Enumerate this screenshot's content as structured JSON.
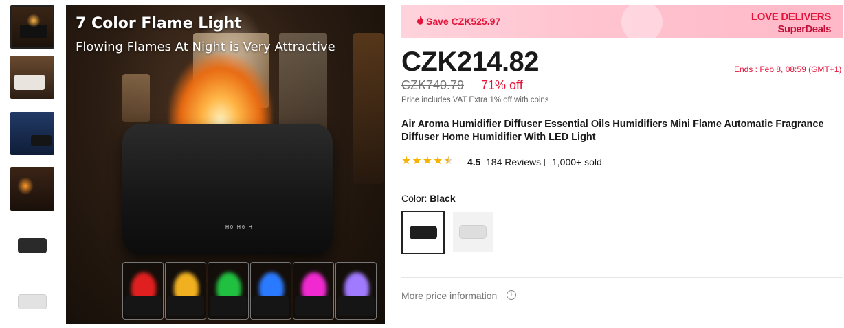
{
  "gallery": {
    "thumbnails": [
      {
        "name": "thumb-1",
        "active": true
      },
      {
        "name": "thumb-2",
        "active": false
      },
      {
        "name": "thumb-3",
        "active": false
      },
      {
        "name": "thumb-4",
        "active": false
      },
      {
        "name": "thumb-5",
        "active": false
      },
      {
        "name": "thumb-6",
        "active": false
      }
    ],
    "main_image": {
      "headline": "7 Color Flame Light",
      "subheadline": "Flowing Flames At Night is Very Attractive"
    }
  },
  "banner": {
    "save_text": "Save CZK525.97",
    "logo_line1": "LOVE DELIVERS",
    "logo_line2": "SuperDeals"
  },
  "pricing": {
    "price": "CZK214.82",
    "original_price": "CZK740.79",
    "discount": "71% off",
    "ends": "Ends :  Feb 8, 08:59 (GMT+1)",
    "vat_note": "Price includes VAT Extra 1% off with coins"
  },
  "product": {
    "title": "Air Aroma Humidifier Diffuser Essential Oils Humidifiers Mini Flame Automatic Fragrance Diffuser Home Humidifier With LED Light",
    "rating": "4.5",
    "rating_value": 4.5,
    "reviews": "184 Reviews",
    "sold": "1,000+ sold"
  },
  "color": {
    "label": "Color:",
    "selected": "Black",
    "options": [
      "Black",
      "White"
    ]
  },
  "more_price_info": "More price information",
  "colors": {
    "accent": "#e4133a",
    "star": "#f5b300"
  }
}
